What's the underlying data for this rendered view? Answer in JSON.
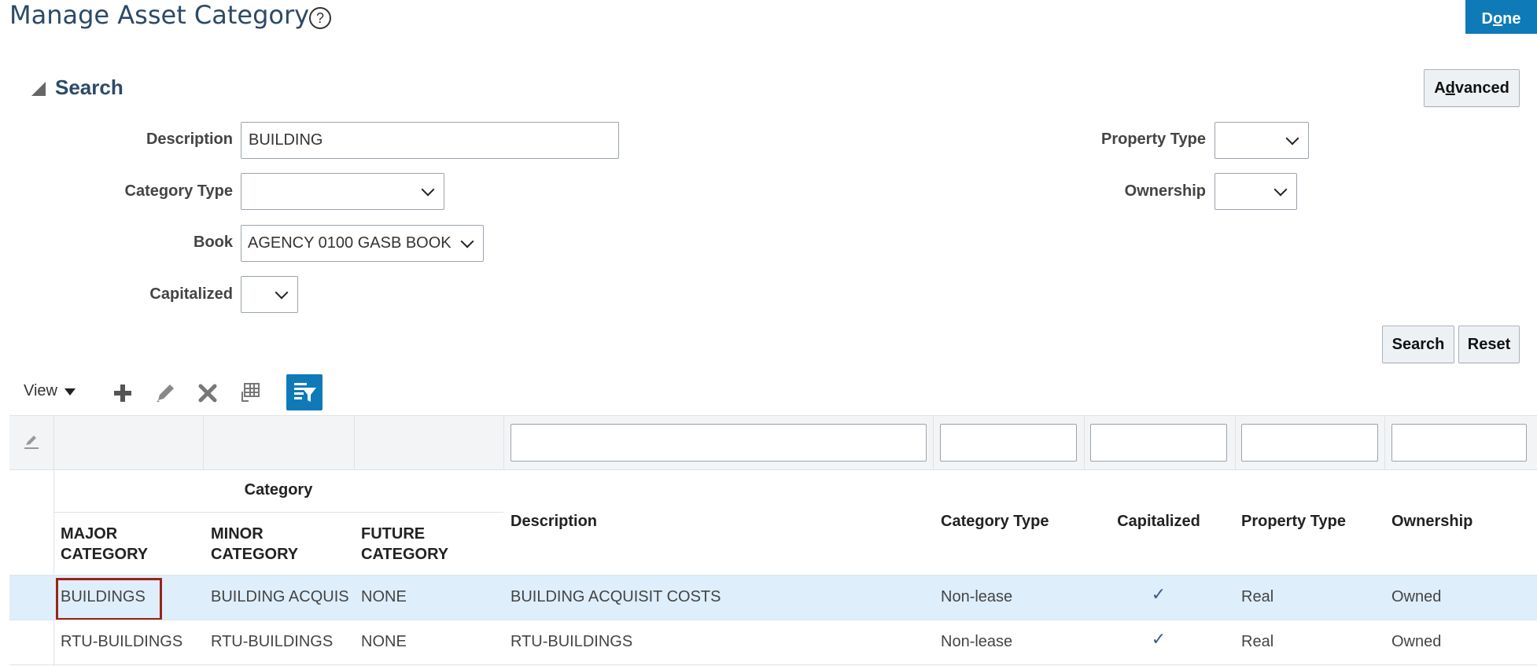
{
  "page": {
    "title": "Manage Asset Category",
    "done_label": "Done",
    "done_access_key": "o"
  },
  "search": {
    "header": "Search",
    "advanced_label": "Advanced",
    "advanced_access_key": "d",
    "fields": {
      "description": {
        "label": "Description",
        "value": "BUILDING"
      },
      "category_type": {
        "label": "Category Type",
        "value": ""
      },
      "book": {
        "label": "Book",
        "value": "AGENCY 0100 GASB BOOK"
      },
      "capitalized": {
        "label": "Capitalized",
        "value": ""
      },
      "property_type": {
        "label": "Property Type",
        "value": ""
      },
      "ownership": {
        "label": "Ownership",
        "value": ""
      }
    },
    "search_label": "Search",
    "reset_label": "Reset"
  },
  "toolbar": {
    "view_label": "View",
    "icons": [
      "add-icon",
      "edit-icon",
      "delete-icon",
      "freeze-icon",
      "query-by-example-icon"
    ]
  },
  "table": {
    "group_header": "Category",
    "columns": {
      "major": "MAJOR CATEGORY",
      "minor": "MINOR CATEGORY",
      "future": "FUTURE CATEGORY",
      "description": "Description",
      "category_type": "Category Type",
      "capitalized": "Capitalized",
      "property_type": "Property Type",
      "ownership": "Ownership"
    },
    "rows": [
      {
        "major": "BUILDINGS",
        "minor": "BUILDING ACQUIS",
        "future": "NONE",
        "description": "BUILDING ACQUISIT COSTS",
        "category_type": "Non-lease",
        "capitalized": "✓",
        "property_type": "Real",
        "ownership": "Owned"
      },
      {
        "major": "RTU-BUILDINGS",
        "minor": "RTU-BUILDINGS",
        "future": "NONE",
        "description": "RTU-BUILDINGS",
        "category_type": "Non-lease",
        "capitalized": "✓",
        "property_type": "Real",
        "ownership": "Owned"
      }
    ]
  },
  "colors": {
    "accent": "#0f7ab8",
    "title": "#2c4a67",
    "selected_row": "#deeefb",
    "highlight_border": "#9b2316"
  }
}
